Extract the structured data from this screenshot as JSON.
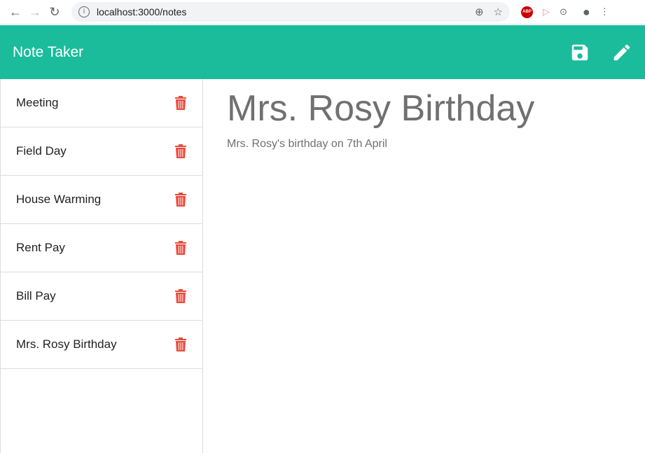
{
  "browser": {
    "url": "localhost:3000/notes"
  },
  "app": {
    "title": "Note Taker"
  },
  "notes": [
    {
      "title": "Meeting"
    },
    {
      "title": "Field Day"
    },
    {
      "title": "House Warming"
    },
    {
      "title": "Rent Pay"
    },
    {
      "title": "Bill Pay"
    },
    {
      "title": "Mrs. Rosy Birthday"
    }
  ],
  "active_note": {
    "title": "Mrs. Rosy Birthday",
    "text": "Mrs. Rosy's birthday on 7th April"
  },
  "colors": {
    "header": "#1abc9c",
    "delete": "#e74c3c"
  }
}
